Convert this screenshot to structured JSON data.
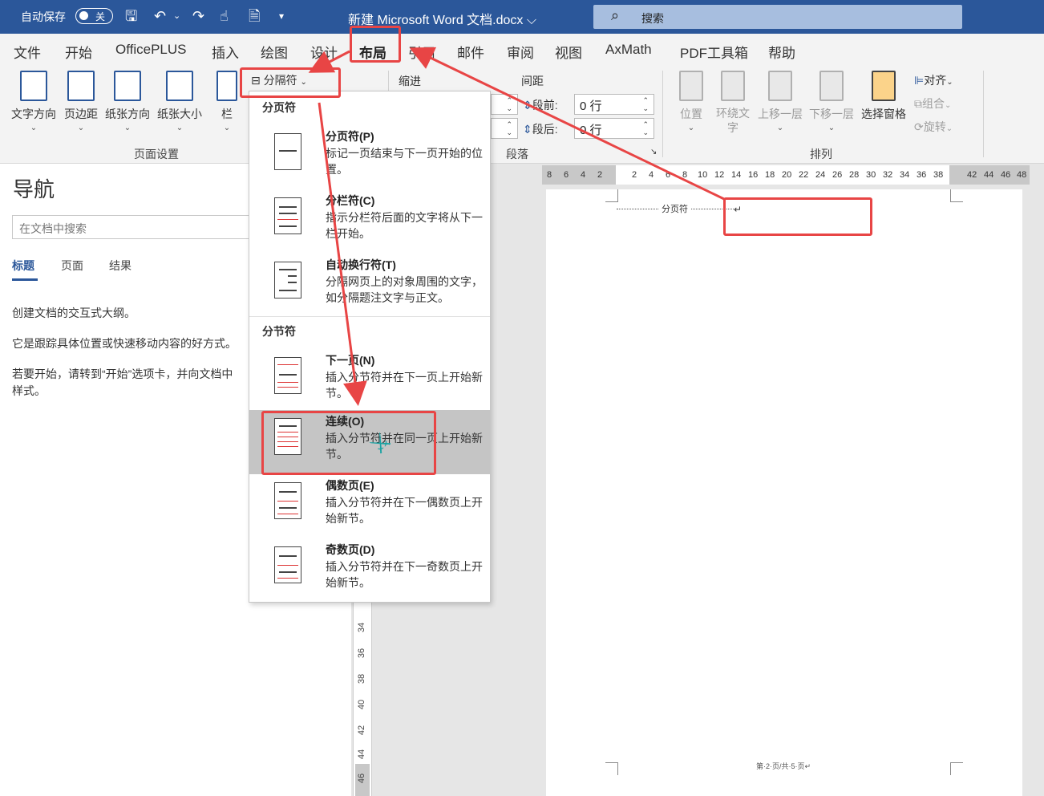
{
  "titlebar": {
    "autosave_label": "自动保存",
    "toggle_text": "关",
    "doc_title": "新建 Microsoft Word 文档.docx ⌵",
    "search_placeholder": "搜索"
  },
  "tabs": [
    "文件",
    "开始",
    "OfficePLUS",
    "插入",
    "绘图",
    "设计",
    "布局",
    "引用",
    "邮件",
    "审阅",
    "视图",
    "AxMath",
    "PDF工具箱",
    "帮助"
  ],
  "active_tab": "布局",
  "ribbon": {
    "page_setup": {
      "label": "页面设置",
      "buttons": [
        "文字方向",
        "页边距",
        "纸张方向",
        "纸张大小",
        "栏"
      ]
    },
    "breaks_button": "分隔符",
    "paragraph": {
      "label": "段落",
      "indent_label": "缩进",
      "spacing_label": "间距",
      "before_label": "段前:",
      "before_value": "0 行",
      "after_label": "段后:",
      "after_value": "0 行"
    },
    "arrange": {
      "label": "排列",
      "buttons": [
        "位置",
        "环绕文字",
        "上移一层",
        "下移一层",
        "选择窗格"
      ],
      "small": [
        "对齐",
        "组合",
        "旋转"
      ]
    }
  },
  "nav": {
    "title": "导航",
    "search_placeholder": "在文档中搜索",
    "tabs": [
      "标题",
      "页面",
      "结果"
    ],
    "p1": "创建文档的交互式大纲。",
    "p2": "它是跟踪具体位置或快速移动内容的好方式。",
    "p3": "若要开始，请转到“开始”选项卡，并向文档中",
    "p3b": "样式。"
  },
  "dropdown": {
    "section1": "分页符",
    "section2": "分节符",
    "items": [
      {
        "title": "分页符(P)",
        "desc": "标记一页结束与下一页开始的位置。"
      },
      {
        "title": "分栏符(C)",
        "desc": "指示分栏符后面的文字将从下一栏开始。"
      },
      {
        "title": "自动换行符(T)",
        "desc": "分隔网页上的对象周围的文字，如分隔题注文字与正文。"
      },
      {
        "title": "下一页(N)",
        "desc": "插入分节符并在下一页上开始新节。"
      },
      {
        "title": "连续(O)",
        "desc": "插入分节符并在同一页上开始新节。"
      },
      {
        "title": "偶数页(E)",
        "desc": "插入分节符并在下一偶数页上开始新节。"
      },
      {
        "title": "奇数页(D)",
        "desc": "插入分节符并在下一奇数页上开始新节。"
      }
    ]
  },
  "hruler": [
    "8",
    "6",
    "4",
    "2",
    "2",
    "4",
    "6",
    "8",
    "10",
    "12",
    "14",
    "16",
    "18",
    "20",
    "22",
    "24",
    "26",
    "28",
    "30",
    "32",
    "34",
    "36",
    "38",
    "42",
    "44",
    "46",
    "48"
  ],
  "vruler": [
    "34",
    "36",
    "38",
    "40",
    "42",
    "44",
    "46"
  ],
  "vruler_top": "3",
  "page": {
    "break_label": "分页符",
    "footer": "第·2·页/共·5·页↵"
  },
  "colors": {
    "titlebar": "#2b579a",
    "annotation": "#e84545",
    "highlight": "#c5c5c5"
  }
}
